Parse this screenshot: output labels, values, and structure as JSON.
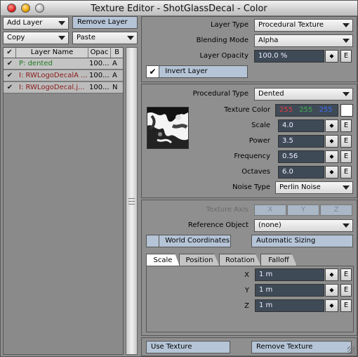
{
  "window": {
    "title": "Texture Editor - ShotGlassDecal - Color"
  },
  "left": {
    "add_layer": "Add Layer",
    "remove_layer": "Remove Layer",
    "copy": "Copy",
    "paste": "Paste",
    "columns": [
      "Layer Name",
      "Opac",
      "B"
    ],
    "layers": [
      {
        "name": "P: dented",
        "opacity": "100...",
        "blend": "A",
        "color": "#1f7a1f"
      },
      {
        "name": "I: RWLogoDecalA ...",
        "opacity": "100...",
        "blend": "A",
        "color": "#8b1a1a"
      },
      {
        "name": "I: RWLogoDecal.j...",
        "opacity": "100...",
        "blend": "N",
        "color": "#8b1a1a"
      }
    ]
  },
  "layer": {
    "type_label": "Layer Type",
    "type_value": "Procedural Texture",
    "blend_label": "Blending Mode",
    "blend_value": "Alpha",
    "opacity_label": "Layer Opacity",
    "opacity_value": "100.0 %",
    "invert_label": "Invert Layer",
    "invert_checked": true
  },
  "procedural": {
    "type_label": "Procedural Type",
    "type_value": "Dented",
    "color_label": "Texture Color",
    "color_r": "255",
    "color_g": "255",
    "color_b": "255",
    "scale_label": "Scale",
    "scale_value": "4.0",
    "power_label": "Power",
    "power_value": "3.5",
    "freq_label": "Frequency",
    "freq_value": "0.56",
    "octaves_label": "Octaves",
    "octaves_value": "6.0",
    "noise_label": "Noise Type",
    "noise_value": "Perlin Noise"
  },
  "mapping": {
    "axis_label": "Texture Axis",
    "axis_x": "X",
    "axis_y": "Y",
    "axis_z": "Z",
    "ref_label": "Reference Object",
    "ref_value": "(none)",
    "world_coords": "World Coordinates",
    "auto_sizing": "Automatic Sizing",
    "tabs": [
      "Scale",
      "Position",
      "Rotation",
      "Falloff"
    ],
    "x_label": "X",
    "x_value": "1 m",
    "y_label": "Y",
    "y_value": "1 m",
    "z_label": "Z",
    "z_value": "1 m"
  },
  "footer": {
    "use_texture": "Use Texture",
    "remove_texture": "Remove Texture"
  },
  "common": {
    "edit": "E",
    "spin": "◆"
  }
}
